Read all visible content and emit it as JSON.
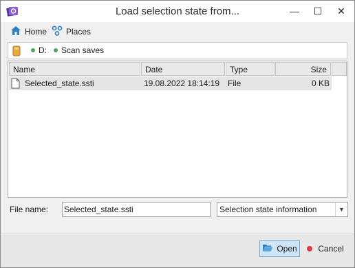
{
  "window": {
    "title": "Load selection state from...",
    "controls": {
      "minimize": "—",
      "maximize": "☐",
      "close": "✕"
    }
  },
  "toolbar": {
    "home_label": "Home",
    "places_label": "Places"
  },
  "pathbar": {
    "crumbs": [
      "D:",
      "Scan saves"
    ]
  },
  "filelist": {
    "columns": [
      "Name",
      "Date",
      "Type",
      "Size"
    ],
    "rows": [
      {
        "name": "Selected_state.ssti",
        "date": "19.08.2022 18:14:19",
        "type": "File",
        "size": "0 KB",
        "icon": "document-icon"
      }
    ]
  },
  "filename": {
    "label": "File name:",
    "value": "Selected_state.ssti"
  },
  "filetype": {
    "selected": "Selection state information"
  },
  "buttons": {
    "open": "Open",
    "cancel": "Cancel"
  },
  "colors": {
    "accent": "#7c4dbf",
    "open_bg": "#cde5f7",
    "cancel_dot": "#e0384a",
    "crumb_dot": "#4aa564",
    "home_icon": "#2f7fc1"
  }
}
